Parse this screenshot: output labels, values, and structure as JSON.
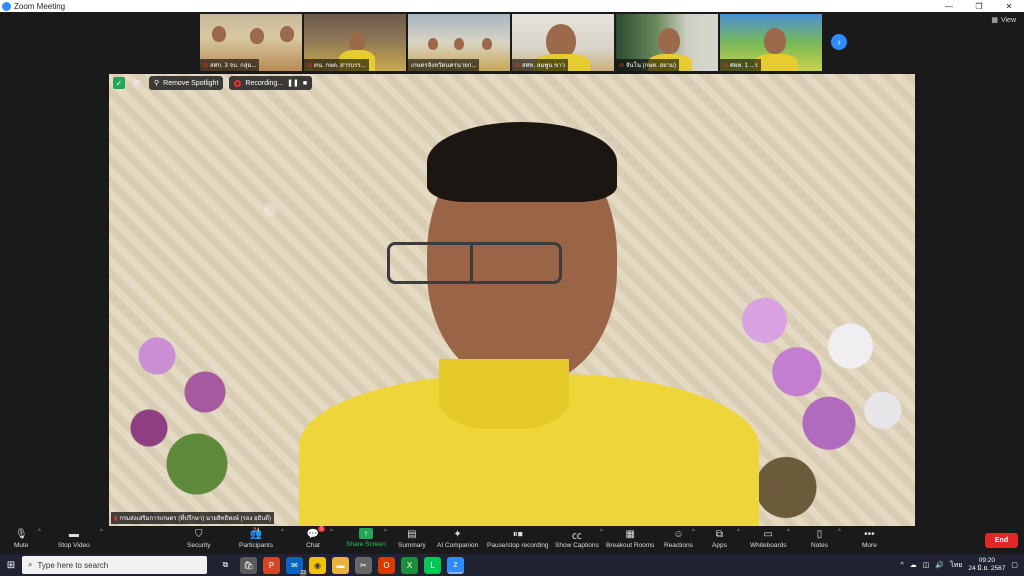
{
  "window": {
    "title": "Zoom Meeting",
    "minimize": "—",
    "restore": "❐",
    "close": "✕"
  },
  "gallery": {
    "view_label": "View",
    "thumbnails": [
      {
        "name": "สศก. 3 จบ. กลุ่ม..."
      },
      {
        "name": "ตน. กษต. สารบรร..."
      },
      {
        "name": "เกษตรจังหวัดนครนายก..."
      },
      {
        "name": "สศท. ลมพูน ขาว"
      },
      {
        "name": "จันโน (กษต. สยาม)"
      },
      {
        "name": "ศผท. 1 ...ร"
      }
    ]
  },
  "spotlight": {
    "remove_label": "Remove Spotlight",
    "recording_label": "Recording...",
    "pause_icon": "❚❚",
    "stop_icon": "■",
    "speaker_name": "กรมส่งเสริมการเกษตร (ที่ปรึกษา) นายสิทธิพงษ์ (รอง อธิบดี)"
  },
  "toolbar": {
    "mute": "Mute",
    "stop_video": "Stop Video",
    "security": "Security",
    "participants": "Participants",
    "participants_count": "24",
    "chat": "Chat",
    "chat_badge": "1",
    "share_screen": "Share Screen",
    "summary": "Summary",
    "ai_companion": "AI Companion",
    "pause_recording": "Pause/stop recording",
    "show_captions": "Show Captions",
    "breakout_rooms": "Breakout Rooms",
    "reactions": "Reactions",
    "apps": "Apps",
    "whiteboards": "Whiteboards",
    "notes": "Notes",
    "more": "More",
    "end": "End"
  },
  "taskbar": {
    "search_placeholder": "Type here to search",
    "lang": "ไทย",
    "time": "09:20",
    "date": "24 มิ.ย. 2567",
    "mail_badge": "22"
  }
}
